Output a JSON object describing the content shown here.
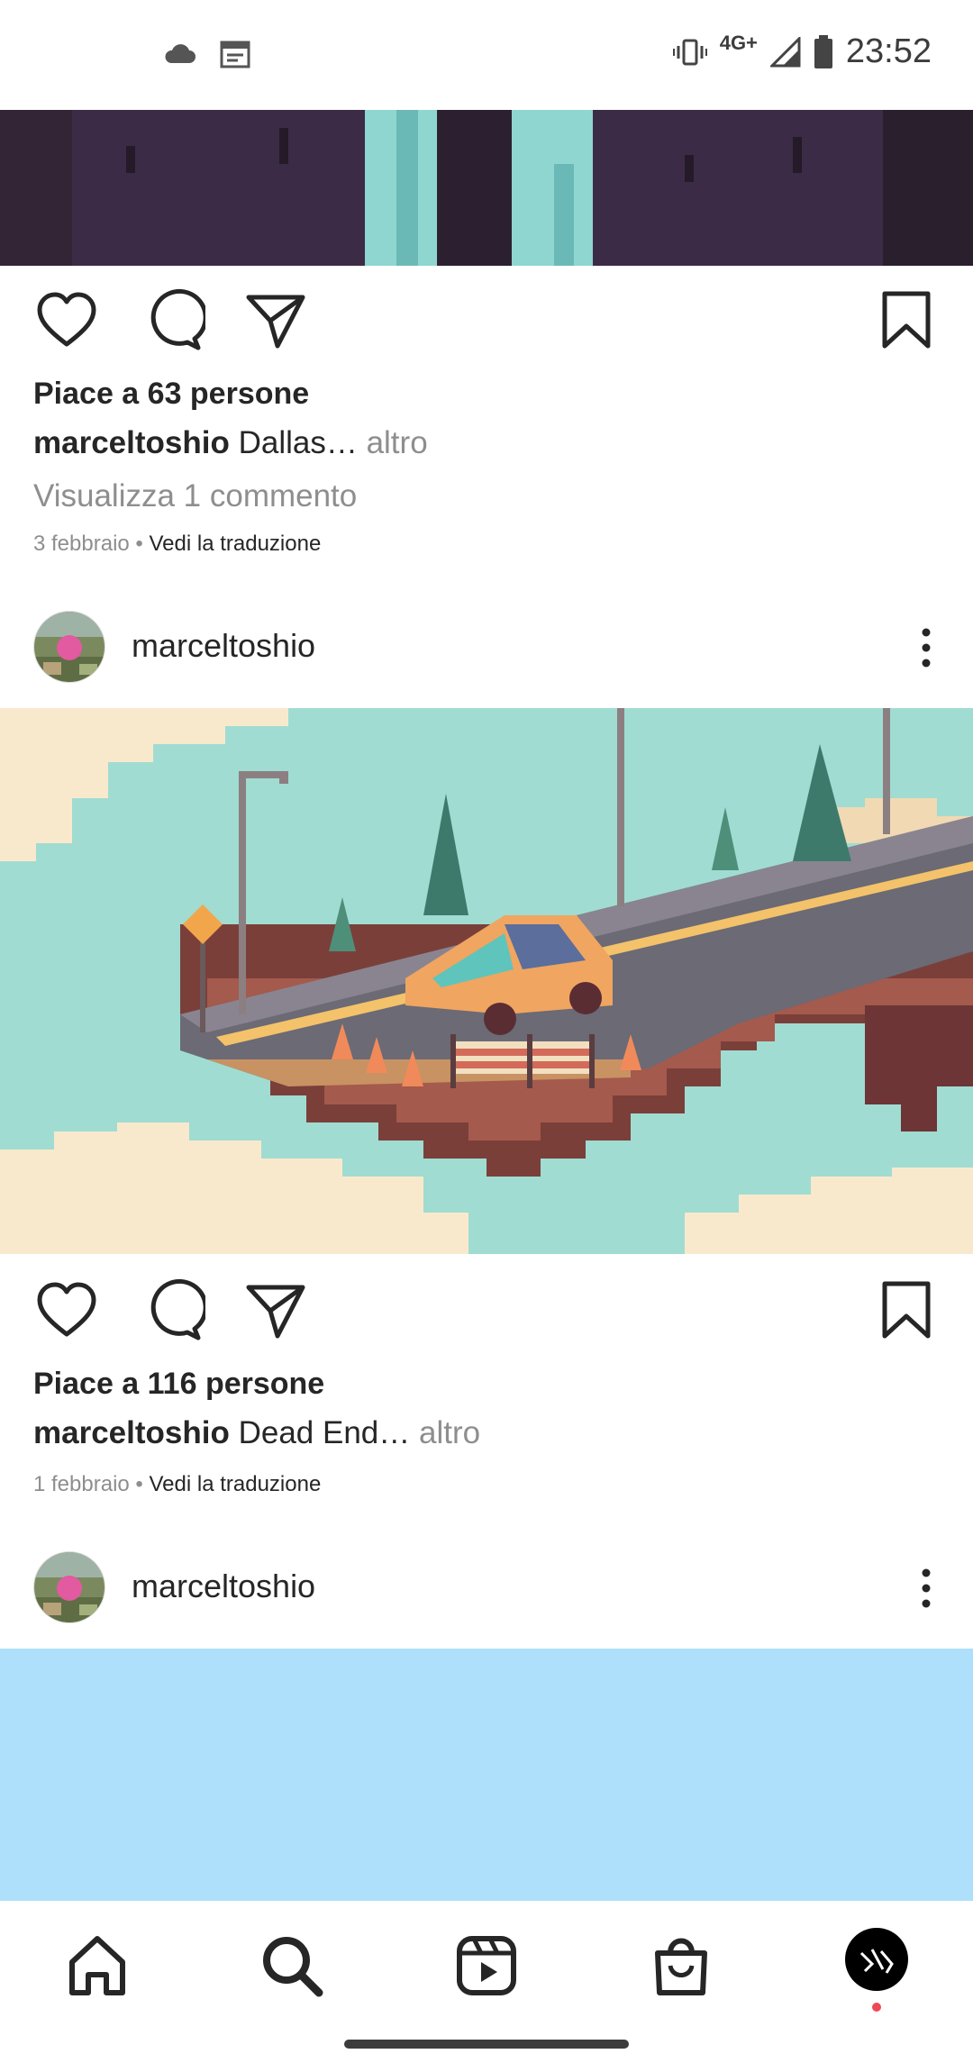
{
  "status_bar": {
    "time": "23:52",
    "network": "4G+",
    "left_icons": [
      "cloud-icon",
      "calendar-widget-icon"
    ],
    "right_icons": [
      "vibrate-icon",
      "signal-icon",
      "battery-icon"
    ]
  },
  "posts": [
    {
      "likes": "Piace a 63 persone",
      "username": "marceltoshio",
      "caption": " Dallas…",
      "more": " altro",
      "comments_link": "Visualizza 1 commento",
      "date": "3 febbraio",
      "separator": " • ",
      "translate": "Vedi la traduzione"
    },
    {
      "header_username": "marceltoshio",
      "likes": "Piace a 116 persone",
      "username": "marceltoshio",
      "caption": " Dead End…",
      "more": " altro",
      "date": "1 febbraio",
      "separator": " • ",
      "translate": "Vedi la traduzione"
    },
    {
      "header_username": "marceltoshio"
    }
  ],
  "nav": [
    "home-icon",
    "search-icon",
    "reels-icon",
    "shop-icon",
    "profile-avatar"
  ],
  "colors": {
    "sky": "#a0dcd2",
    "cloud": "#f9e9cc",
    "dark_purple": "#3a2a40",
    "teal": "#8fd6d0",
    "light_blue": "#aee0fb",
    "notification_dot": "#ed4956"
  }
}
